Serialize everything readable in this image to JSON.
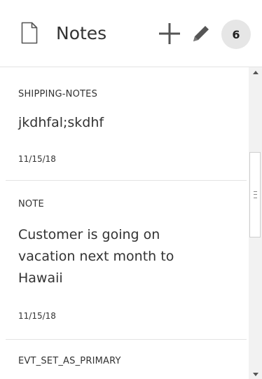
{
  "header": {
    "title": "Notes",
    "icons": {
      "document": "document-icon",
      "add": "plus-icon",
      "edit": "pencil-icon"
    },
    "count": "6"
  },
  "notes": [
    {
      "type": "SHIPPING-NOTES",
      "body": "jkdhfal;skdhf",
      "date": "11/15/18"
    },
    {
      "type": "NOTE",
      "body_lines": [
        "Customer is going on",
        "vacation next month to",
        "Hawaii"
      ],
      "date": "11/15/18"
    },
    {
      "type": "EVT_SET_AS_PRIMARY"
    }
  ],
  "colors": {
    "text": "#333333",
    "divider": "#e3e3e3",
    "badge_bg": "#e6e6e6",
    "icon": "#555555"
  }
}
